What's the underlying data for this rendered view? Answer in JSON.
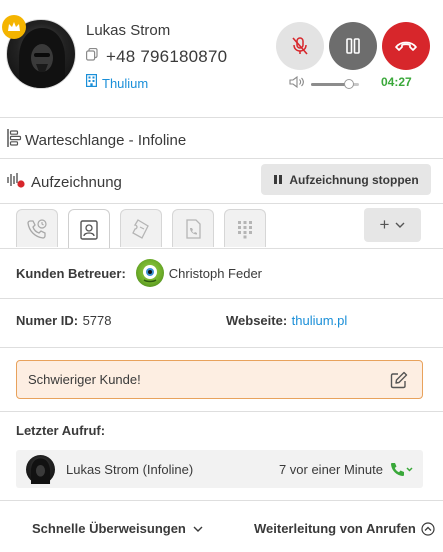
{
  "caller": {
    "name": "Lukas Strom",
    "phone": "+48 796180870",
    "company": "Thulium"
  },
  "call": {
    "timer": "04:27",
    "volume_level": 0.8
  },
  "queue": {
    "label": "Warteschlange - Infoline"
  },
  "recording": {
    "label": "Aufzeichnung",
    "button_label": "Aufzeichnung stoppen"
  },
  "tabs": [
    {
      "icon": "phone-history-icon",
      "active": false
    },
    {
      "icon": "contact-card-icon",
      "active": true
    },
    {
      "icon": "ticket-icon",
      "active": false
    },
    {
      "icon": "document-phone-icon",
      "active": false
    },
    {
      "icon": "dialpad-icon",
      "active": false
    }
  ],
  "tab_add": {
    "label": "+"
  },
  "details": {
    "advisor_label": "Kunden Betreuer:",
    "advisor_name": "Christoph Feder",
    "id_label": "Numer ID:",
    "id_value": "5778",
    "website_label": "Webseite:",
    "website_value": "thulium.pl"
  },
  "note": {
    "text": "Schwieriger Kunde!"
  },
  "last_call": {
    "label": "Letzter Aufruf:",
    "name": "Lukas Strom (Infoline)",
    "time": "7 vor einer Minute"
  },
  "footer": {
    "quick_transfers": "Schnelle Überweisungen",
    "call_forwarding": "Weiterleitung von Anrufen"
  },
  "colors": {
    "accent_blue": "#1a8fd8",
    "hangup_red": "#d7262b",
    "timer_green": "#3aa83a",
    "note_border": "#e8a25c",
    "note_bg": "#fdeee2",
    "crown_gold": "#f4b400"
  }
}
